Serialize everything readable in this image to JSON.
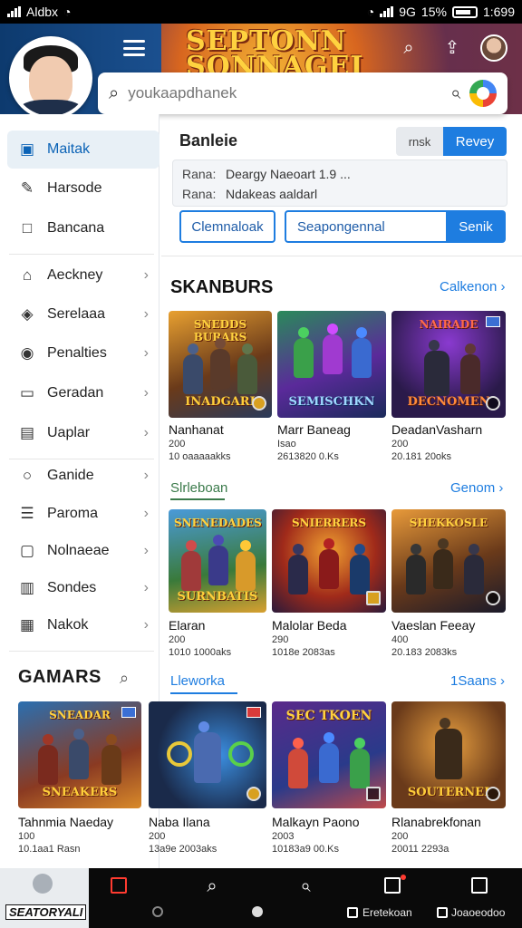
{
  "status_bar": {
    "carrier": "Aldbx",
    "battery": "15%",
    "network": "9G",
    "time": "1:699"
  },
  "header": {
    "title_line1": "SEPTONN",
    "title_line2": "SONNAGEI"
  },
  "search": {
    "placeholder": "youkaapdhanek"
  },
  "sidebar": {
    "items": [
      {
        "label": "Maitak",
        "icon": "bookmark-icon",
        "chevron": false
      },
      {
        "label": "Harsode",
        "icon": "edit-icon",
        "chevron": false
      },
      {
        "label": "Bancana",
        "icon": "doc-icon",
        "chevron": false
      },
      {
        "label": "Aeckney",
        "icon": "home-icon",
        "chevron": true
      },
      {
        "label": "Serelaaa",
        "icon": "tag-icon",
        "chevron": true
      },
      {
        "label": "Penalties",
        "icon": "shield-icon",
        "chevron": true
      },
      {
        "label": "Geradan",
        "icon": "card-icon",
        "chevron": true
      },
      {
        "label": "Uaplar",
        "icon": "cart-icon",
        "chevron": true
      },
      {
        "label": "Ganide",
        "icon": "circle-icon",
        "chevron": true
      },
      {
        "label": "Paroma",
        "icon": "list-icon",
        "chevron": true
      },
      {
        "label": "Nolnaeae",
        "icon": "file-icon",
        "chevron": true
      },
      {
        "label": "Sondes",
        "icon": "page-icon",
        "chevron": true
      },
      {
        "label": "Nakok",
        "icon": "grid-icon",
        "chevron": true
      }
    ],
    "section_title": "GAMARS",
    "games": [
      {
        "name": "Tahnmia Naeday",
        "meta1": "100",
        "meta2": "10.1aa1 Rasn",
        "img_top": "SNEADAR",
        "img_bottom": "SNEAKERS",
        "theme": "a"
      },
      {
        "name": "Naba Ilana",
        "meta1": "200",
        "meta2": "13a9e 2003aks",
        "img_top": "",
        "img_bottom": "",
        "theme": "b"
      },
      {
        "name": "Malkayn Paono",
        "meta1": "2003",
        "meta2": "10183a9 00.Ks",
        "img_top": "SEC TKOEN",
        "img_bottom": "",
        "theme": "c"
      },
      {
        "name": "Rlanabrekfonan",
        "meta1": "200",
        "meta2": "20011 2293a",
        "img_top": "",
        "img_bottom": "SOUTERNEI",
        "theme": "d"
      }
    ]
  },
  "panel": {
    "title": "Banleie",
    "ghost_btn": "rnsk",
    "primary_btn": "Revey",
    "info": [
      {
        "label": "Rana:",
        "value": "Deargy Naeoart 1.9 ..."
      },
      {
        "label": "Rana:",
        "value": "Ndakeas aaldarl"
      }
    ],
    "outline_btn": "Clemnaloak",
    "search_value": "Seapongennal",
    "search_btn": "Senik"
  },
  "sections": [
    {
      "title": "SKANBURS",
      "link": "Calkenon",
      "cards": [
        {
          "name": "Nanhanat",
          "meta1": "200",
          "meta2": "10 oaaaaakks",
          "img_top": "SNEDDS BURARS",
          "img_bottom": "INADGARI",
          "theme": "a"
        },
        {
          "name": "Marr Baneag",
          "meta1": "Isao",
          "meta2": "2613820 0.Ks",
          "img_top": "",
          "img_bottom": "SEMISCHKN",
          "theme": "e"
        },
        {
          "name": "DeadanVasharn",
          "meta1": "200",
          "meta2": "20.181 20oks",
          "img_top": "NAIRADE",
          "img_bottom": "DECNOMEN",
          "theme": "f"
        }
      ]
    },
    {
      "subtitle": "Slrleboan",
      "link": "Genom",
      "cards": [
        {
          "name": "Elaran",
          "meta1": "200",
          "meta2": "1010 1000aks",
          "img_top": "SNENEDADES",
          "img_bottom": "SURNBATIS",
          "theme": "g"
        },
        {
          "name": "Malolar Beda",
          "meta1": "290",
          "meta2": "1018e 2083as",
          "img_top": "SNIERRERS",
          "img_bottom": "",
          "theme": "h"
        },
        {
          "name": "Vaeslan Feeay",
          "meta1": "400",
          "meta2": "20.183 2083ks",
          "img_top": "SHEKKOSLE",
          "img_bottom": "",
          "theme": "i"
        }
      ]
    },
    {
      "subtitle": "Lleworka",
      "link": "1Saans"
    }
  ],
  "bottom_nav": {
    "home_label": "SEATORYALI",
    "bottom_left_label": "Eretekoan",
    "bottom_right_label": "Joaoeodoo"
  }
}
